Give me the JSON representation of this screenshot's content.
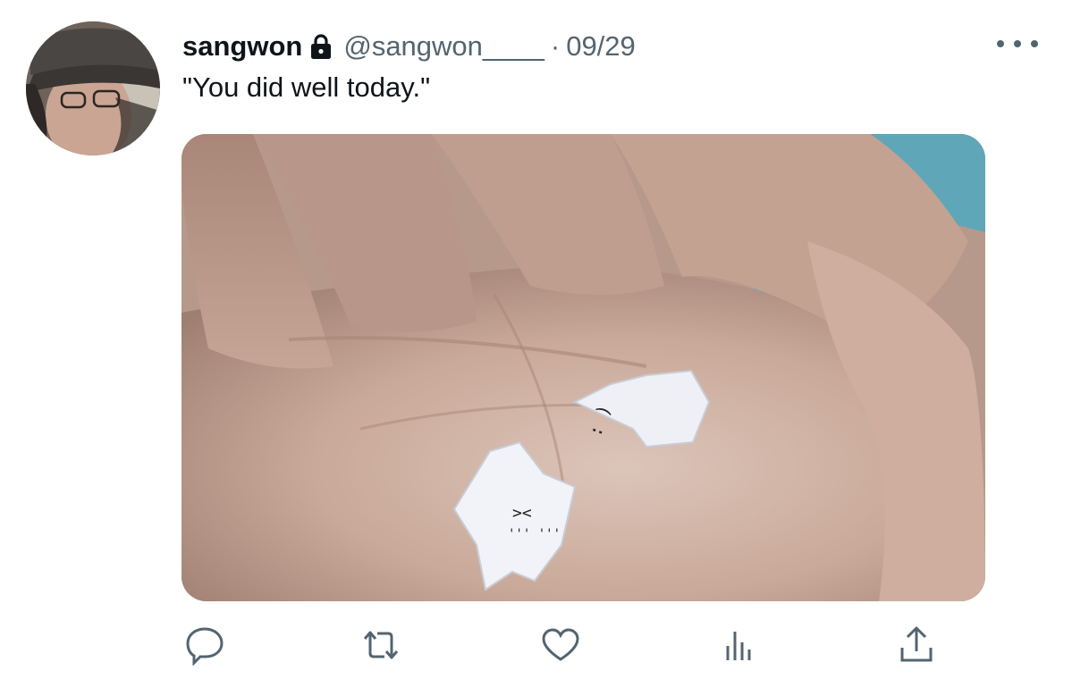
{
  "tweet": {
    "display_name": "sangwon",
    "handle": "@sangwon____",
    "separator": "·",
    "date": "09/29",
    "text": "\"You did well today.\"",
    "protected_icon": "lock-icon",
    "more_icon": "more-horizontal-icon"
  },
  "actions": [
    {
      "name": "reply",
      "icon": "reply-icon"
    },
    {
      "name": "retweet",
      "icon": "retweet-icon"
    },
    {
      "name": "like",
      "icon": "heart-icon"
    },
    {
      "name": "analytics",
      "icon": "analytics-icon"
    },
    {
      "name": "share",
      "icon": "share-icon"
    }
  ],
  "colors": {
    "primary_text": "#0f1419",
    "secondary_text": "#536471",
    "background": "#ffffff"
  }
}
